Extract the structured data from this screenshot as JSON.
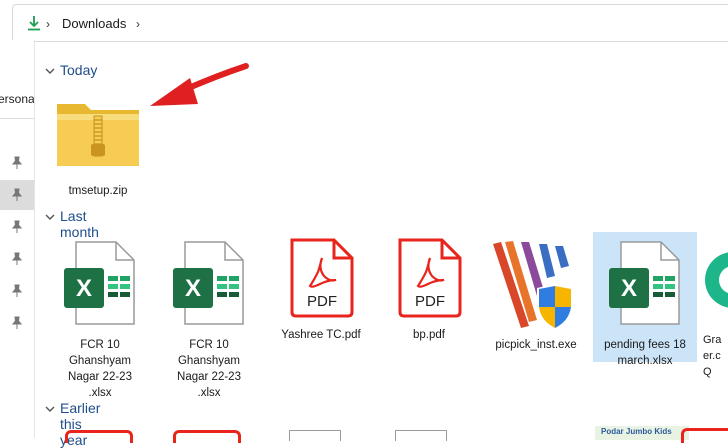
{
  "address_bar": {
    "location_icon": "download-arrow-icon",
    "location": "Downloads"
  },
  "nav_pane": {
    "partial_label": "ersona",
    "pin_icon": "pin-icon"
  },
  "groups": {
    "today": "Today",
    "last_month": "Last month",
    "earlier_this_year": "Earlier this year"
  },
  "files": {
    "today": [
      {
        "name": "tmsetup.zip",
        "icon": "zip-folder-icon"
      }
    ],
    "last_month": [
      {
        "name": "FCR 10 Ghanshyam Nagar 22-23 .xlsx",
        "icon": "excel-icon"
      },
      {
        "name": "FCR 10 Ghanshyam Nagar 22-23 .xlsx",
        "icon": "excel-icon"
      },
      {
        "name": "Yashree TC.pdf",
        "icon": "pdf-icon"
      },
      {
        "name": "bp.pdf",
        "icon": "pdf-icon"
      },
      {
        "name": "picpick_inst.exe",
        "icon": "installer-icon"
      },
      {
        "name": "pending fees 18 march.xlsx",
        "icon": "excel-icon"
      },
      {
        "name": "Gra er.c Q",
        "icon": "app-icon"
      }
    ],
    "earlier_this_year_partial": "Podar Jumbo Kids"
  },
  "annotation": {
    "arrow_color": "#e02020"
  },
  "colors": {
    "group_title": "#1f4e8c",
    "excel_green": "#1e7145",
    "pdf_red": "#e8241c",
    "selection": "#cce4f7"
  }
}
